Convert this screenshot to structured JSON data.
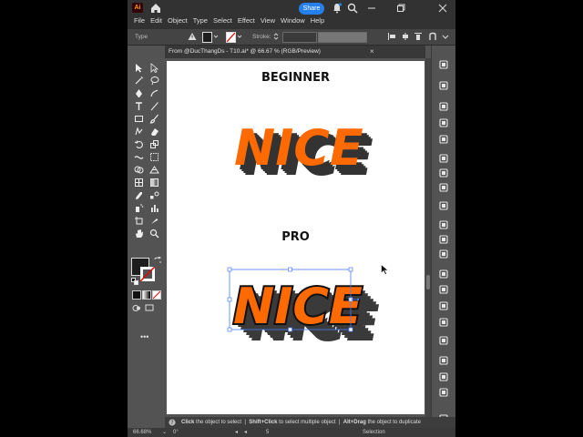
{
  "app": {
    "logo": "Ai",
    "share_label": "Share",
    "accent": "#2680eb"
  },
  "menu": [
    "File",
    "Edit",
    "Object",
    "Type",
    "Select",
    "Effect",
    "View",
    "Window",
    "Help"
  ],
  "controlbar": {
    "mode_label": "Type",
    "stroke_label": "Stroke:"
  },
  "tab": {
    "title": "From @DucThangDs - T10.ai* @ 66.67 % (RGB/Preview)",
    "close": "×"
  },
  "artboard": {
    "label_beginner": "BEGINNER",
    "label_pro": "PRO",
    "nice_text": "NICE",
    "nice_color": "#ff6a00",
    "nice_shadow_color": "#333333"
  },
  "hint": {
    "click_bold": "Click",
    "click_text": "the object to select",
    "shift_bold": "Shift+Click",
    "shift_text": "to select multiple object",
    "alt_bold": "Alt+Drag",
    "alt_text": "the object to duplicate"
  },
  "status": {
    "zoom": "66.68%",
    "rotation": "0°",
    "artboard_nav": "5",
    "tool": "Selection"
  },
  "tools": [
    "selection-tool",
    "direct-selection-tool",
    "magic-wand-tool",
    "lasso-tool",
    "pen-tool",
    "curvature-tool",
    "type-tool",
    "line-tool",
    "rectangle-tool",
    "paintbrush-tool",
    "shaper-tool",
    "eraser-tool",
    "rotate-tool",
    "scale-tool",
    "width-tool",
    "free-transform-tool",
    "shape-builder-tool",
    "perspective-grid-tool",
    "mesh-tool",
    "gradient-tool",
    "eyedropper-tool",
    "blend-tool",
    "symbol-sprayer-tool",
    "column-graph-tool",
    "artboard-tool",
    "slice-tool",
    "hand-tool",
    "zoom-tool"
  ],
  "right_panel_icons": [
    "properties-icon",
    "libraries-icon",
    "color-icon",
    "swatches-icon",
    "gradient-icon",
    "brushes-icon",
    "symbols-icon",
    "appearance-icon",
    "transparency-icon",
    "align-icon",
    "transform-icon",
    "pathfinder-icon",
    "stroke-icon",
    "links-icon",
    "paragraph-icon",
    "character-icon",
    "opentype-icon",
    "layers-icon",
    "export-icon",
    "artboards-icon",
    "comments-icon"
  ]
}
